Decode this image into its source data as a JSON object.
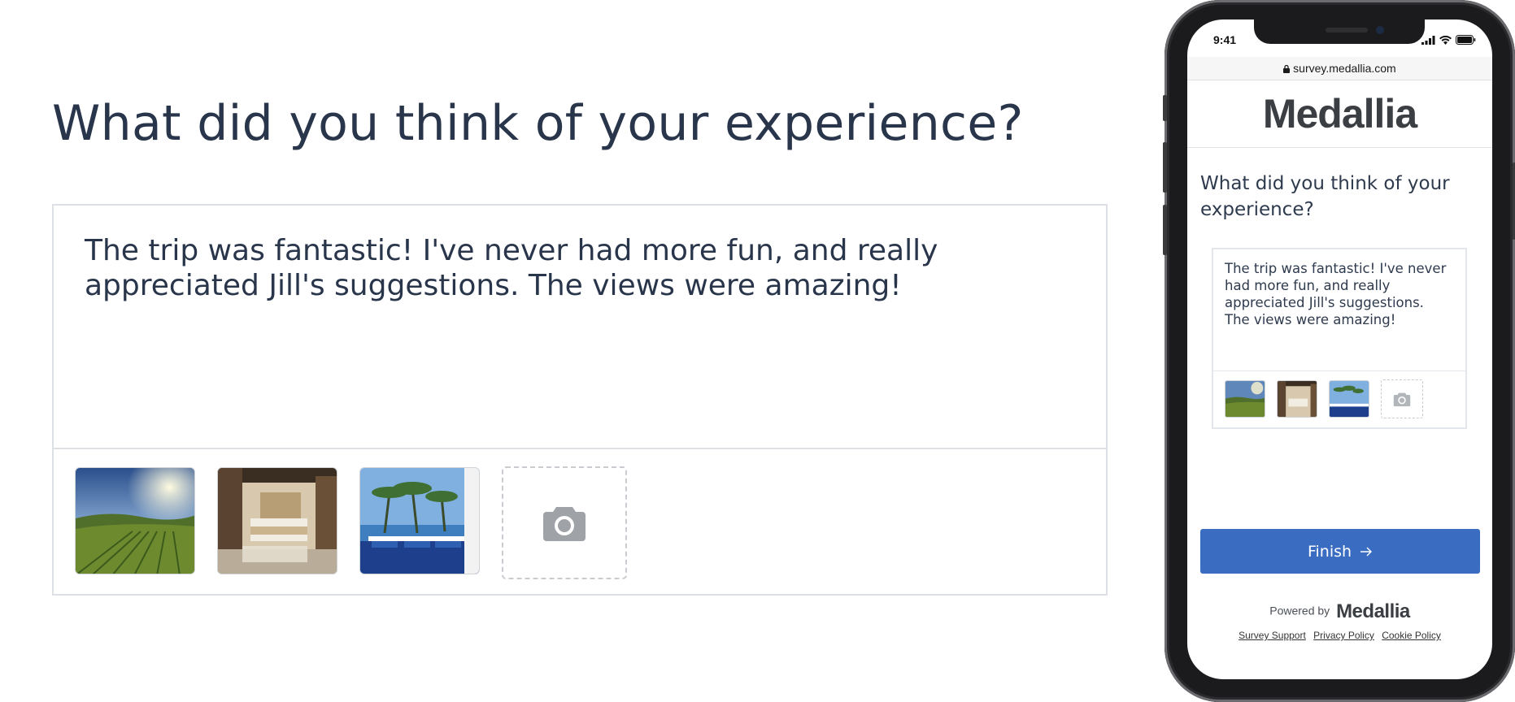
{
  "desktop": {
    "question": "What did you think of your experience?",
    "answer": "The trip was fantastic! I've never had more fun, and really appreciated Jill's suggestions. The views were amazing!",
    "photos": [
      {
        "icon": "vineyard-photo"
      },
      {
        "icon": "hotel-room-photo"
      },
      {
        "icon": "pool-deck-photo"
      }
    ],
    "add_photo_icon": "camera-icon"
  },
  "phone": {
    "status_time": "9:41",
    "url": "survey.medallia.com",
    "brand": "Medallia",
    "question": "What did you think of your experience?",
    "answer": "The trip was fantastic! I've never had more fun, and really appreciated Jill's suggestions. The views were amazing!",
    "finish_label": "Finish",
    "finish_icon": "arrow-right-icon",
    "powered_by": "Powered by",
    "powered_brand": "Medallia",
    "links": [
      "Survey Support",
      "Privacy Policy",
      "Cookie Policy"
    ]
  },
  "colors": {
    "primary_button": "#3a6cc1",
    "text": "#28354a",
    "border": "#dde1e6"
  }
}
